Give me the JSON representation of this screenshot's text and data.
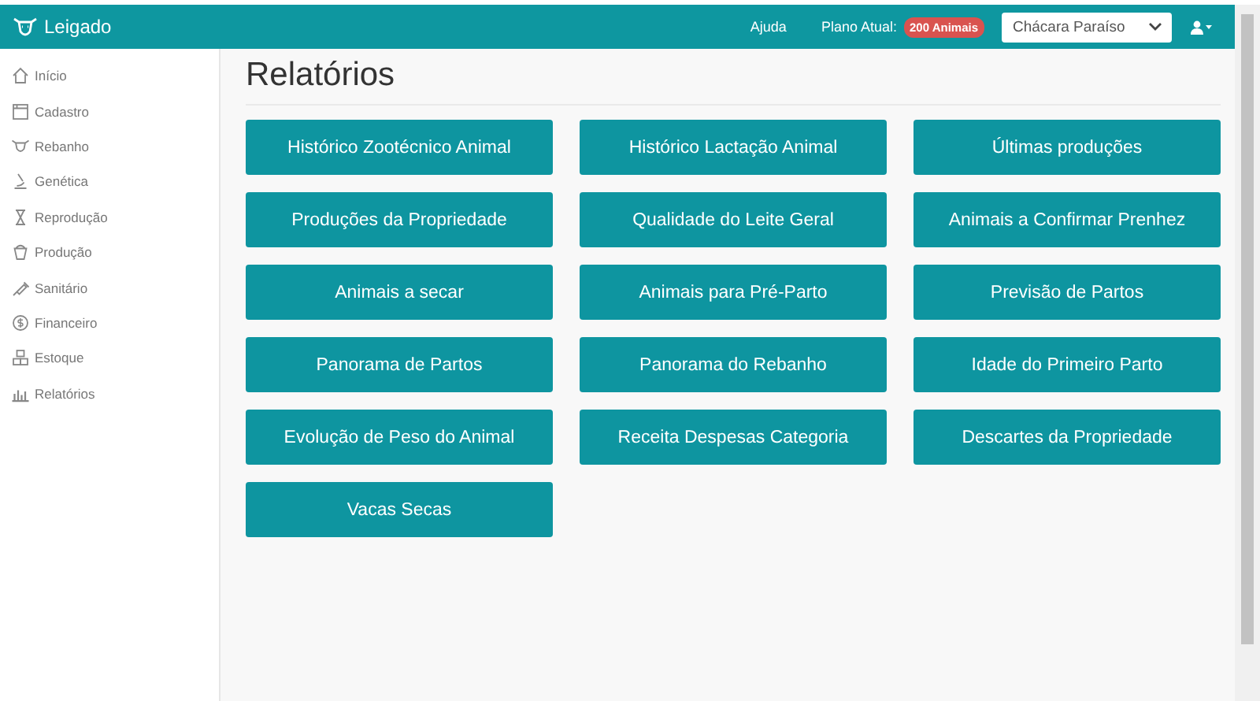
{
  "navbar": {
    "brand": "Leigado",
    "links": [
      "Ajuda"
    ],
    "plan_label": "Plano Atual:",
    "plan_badge": "200 Animais",
    "farm_select": {
      "value": "Chácara Paraíso"
    }
  },
  "sidebar": {
    "items": [
      {
        "label": "Início"
      },
      {
        "label": "Cadastro"
      },
      {
        "label": "Rebanho"
      },
      {
        "label": "Genética"
      },
      {
        "label": "Reprodução"
      },
      {
        "label": "Produção"
      },
      {
        "label": "Sanitário"
      },
      {
        "label": "Financeiro"
      },
      {
        "label": "Estoque"
      },
      {
        "label": "Relatórios"
      }
    ]
  },
  "page": {
    "title": "Relatórios",
    "reports": [
      "Histórico Zootécnico Animal",
      "Histórico Lactação Animal",
      "Últimas produções",
      "Produções da Propriedade",
      "Qualidade do Leite Geral",
      "Animais a Confirmar Prenhez",
      "Animais a secar",
      "Animais para Pré-Parto",
      "Previsão de Partos",
      "Panorama de Partos",
      "Panorama do Rebanho",
      "Idade do Primeiro Parto",
      "Evolução de Peso do Animal",
      "Receita Despesas Categoria",
      "Descartes da Propriedade",
      "Vacas Secas"
    ]
  }
}
